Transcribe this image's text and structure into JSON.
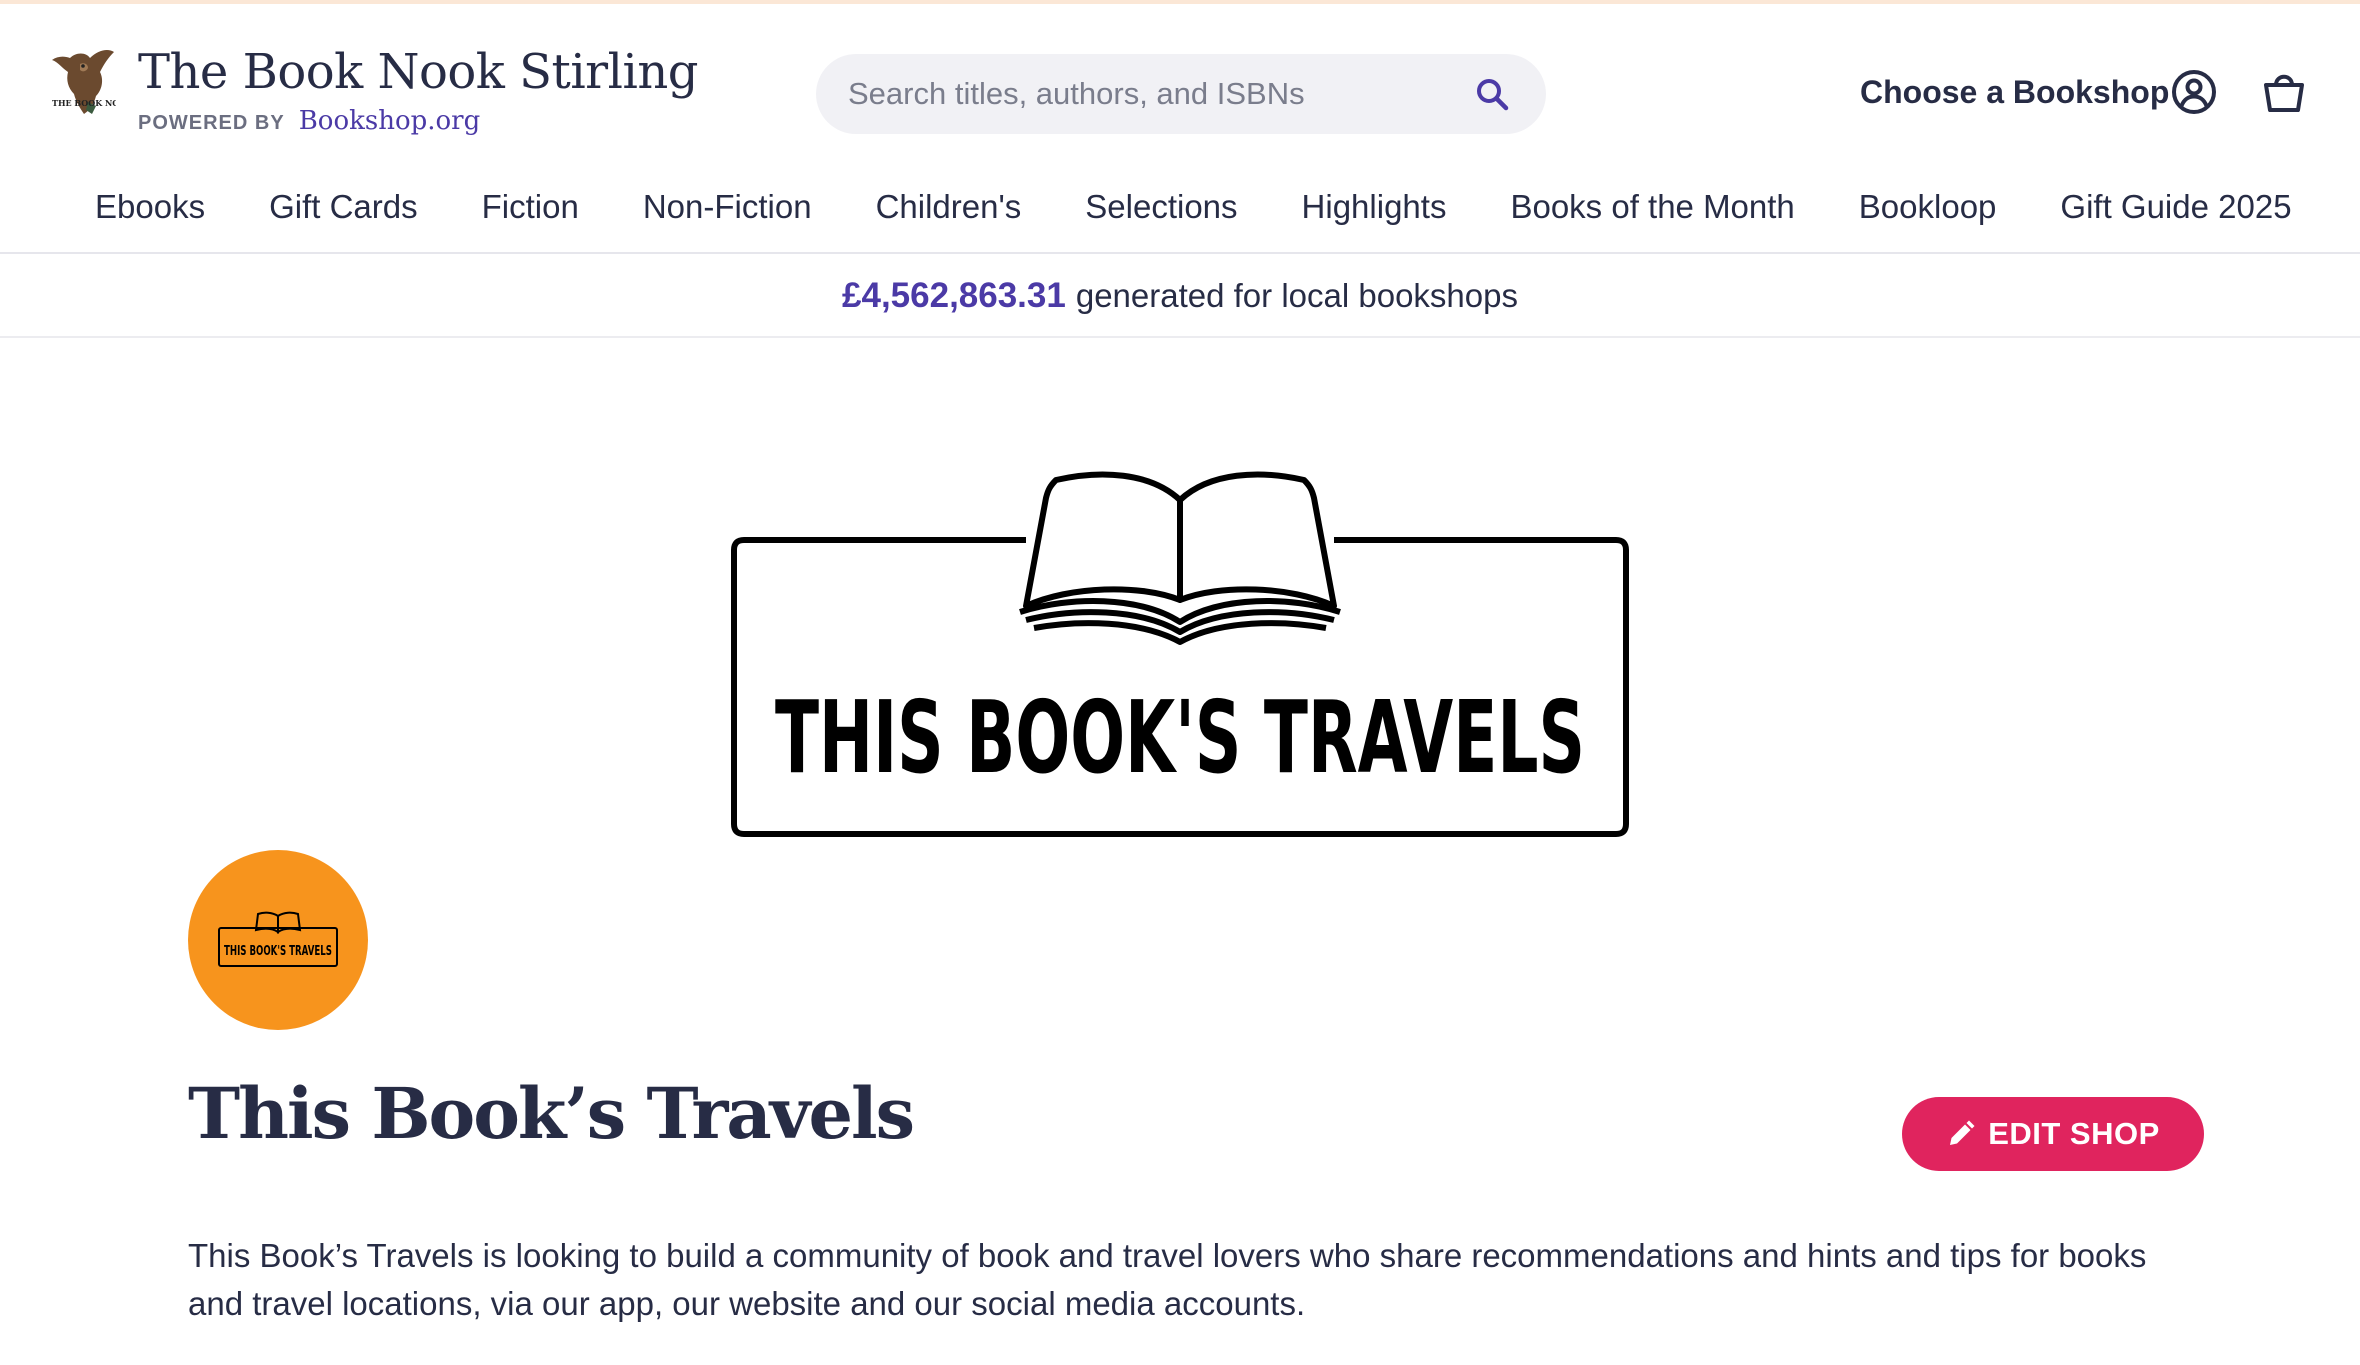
{
  "header": {
    "store_name": "The Book Nook Stirling",
    "powered_by_label": "POWERED BY",
    "powered_by_link": "Bookshop.org",
    "search": {
      "placeholder": "Search titles, authors, and ISBNs",
      "value": ""
    },
    "choose_bookshop": "Choose a Bookshop",
    "logo_lettering": "THE BOOK NOOK"
  },
  "nav": {
    "items": [
      {
        "label": "Ebooks"
      },
      {
        "label": "Gift Cards"
      },
      {
        "label": "Fiction"
      },
      {
        "label": "Non-Fiction"
      },
      {
        "label": "Children's"
      },
      {
        "label": "Selections"
      },
      {
        "label": "Highlights"
      },
      {
        "label": "Books of the Month"
      },
      {
        "label": "Bookloop"
      },
      {
        "label": "Gift Guide 2025"
      }
    ]
  },
  "banner": {
    "amount": "£4,562,863.31",
    "text": "generated for local bookshops"
  },
  "shop": {
    "logo_text": "THIS BOOK'S TRAVELS",
    "title": "This Book’s Travels",
    "edit_label": "EDIT SHOP",
    "description": "This Book’s Travels is looking to build a community of book and travel lovers who share recommendations and hints and tips for books and travel locations, via our app, our website and our social media accounts."
  },
  "colors": {
    "accent_purple": "#4b3aa6",
    "edit_button": "#e0245e",
    "avatar_bg": "#f7941d",
    "text_dark": "#272c45"
  },
  "icons": [
    "owl-logo-icon",
    "search-icon",
    "account-icon",
    "shopping-bag-icon",
    "pencil-icon",
    "open-book-icon"
  ]
}
